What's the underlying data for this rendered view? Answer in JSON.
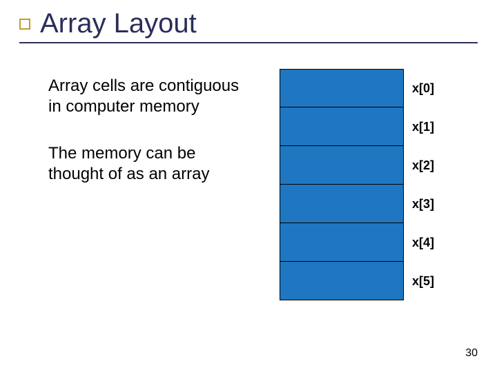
{
  "title": "Array Layout",
  "paragraphs": [
    "Array cells are contiguous in computer memory",
    "The memory can be thought of as an array"
  ],
  "cells": {
    "labels": [
      "x[0]",
      "x[1]",
      "x[2]",
      "x[3]",
      "x[4]",
      "x[5]"
    ],
    "fill": "#1f77c1"
  },
  "page_number": "30"
}
